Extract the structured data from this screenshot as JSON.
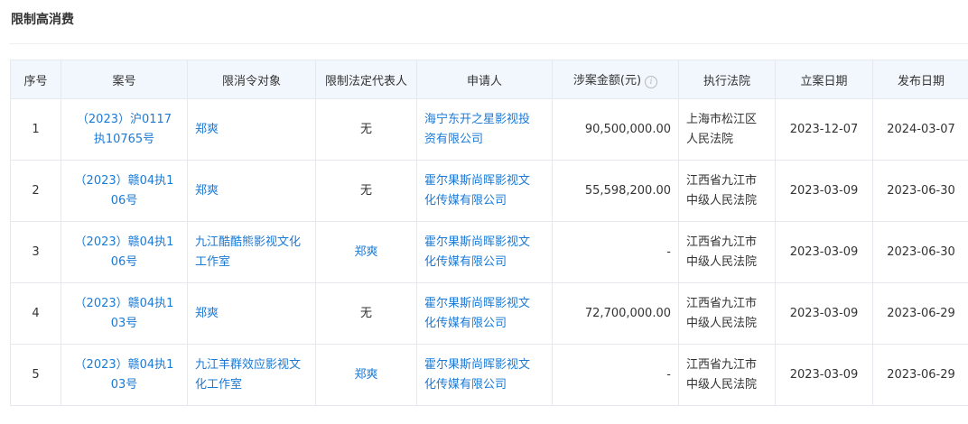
{
  "section": {
    "title": "限制高消费"
  },
  "table": {
    "headers": [
      "序号",
      "案号",
      "限消令对象",
      "限制法定代表人",
      "申请人",
      "涉案金额(元)",
      "执行法院",
      "立案日期",
      "发布日期"
    ],
    "info_icon": "info-circle-icon",
    "rows": [
      {
        "index": "1",
        "case_no": "（2023）沪0117执10765号",
        "case_no_lines": [
          "（2023）沪0117",
          "执10765号"
        ],
        "subject": "郑爽",
        "subject_lines": [
          "郑爽"
        ],
        "subject_link": true,
        "legal_rep": "无",
        "legal_rep_link": false,
        "applicant_lines": [
          "海宁东开之星影视投",
          "资有限公司"
        ],
        "amount": "90,500,000.00",
        "court_lines": [
          "上海市松江区",
          "人民法院"
        ],
        "filed_date": "2023-12-07",
        "publish_date": "2024-03-07"
      },
      {
        "index": "2",
        "case_no_lines": [
          "（2023）赣04执1",
          "06号"
        ],
        "subject_lines": [
          "郑爽"
        ],
        "legal_rep": "无",
        "legal_rep_link": false,
        "applicant_lines": [
          "霍尔果斯尚晖影视文",
          "化传媒有限公司"
        ],
        "amount": "55,598,200.00",
        "court_lines": [
          "江西省九江市",
          "中级人民法院"
        ],
        "filed_date": "2023-03-09",
        "publish_date": "2023-06-30"
      },
      {
        "index": "3",
        "case_no_lines": [
          "（2023）赣04执1",
          "06号"
        ],
        "subject_lines": [
          "九江酷酷熊影视文化",
          "工作室"
        ],
        "legal_rep": "郑爽",
        "legal_rep_link": true,
        "applicant_lines": [
          "霍尔果斯尚晖影视文",
          "化传媒有限公司"
        ],
        "amount": "-",
        "court_lines": [
          "江西省九江市",
          "中级人民法院"
        ],
        "filed_date": "2023-03-09",
        "publish_date": "2023-06-30"
      },
      {
        "index": "4",
        "case_no_lines": [
          "（2023）赣04执1",
          "03号"
        ],
        "subject_lines": [
          "郑爽"
        ],
        "legal_rep": "无",
        "legal_rep_link": false,
        "applicant_lines": [
          "霍尔果斯尚晖影视文",
          "化传媒有限公司"
        ],
        "amount": "72,700,000.00",
        "court_lines": [
          "江西省九江市",
          "中级人民法院"
        ],
        "filed_date": "2023-03-09",
        "publish_date": "2023-06-29"
      },
      {
        "index": "5",
        "case_no_lines": [
          "（2023）赣04执1",
          "03号"
        ],
        "subject_lines": [
          "九江羊群效应影视文",
          "化工作室"
        ],
        "legal_rep": "郑爽",
        "legal_rep_link": true,
        "applicant_lines": [
          "霍尔果斯尚晖影视文",
          "化传媒有限公司"
        ],
        "amount": "-",
        "court_lines": [
          "江西省九江市",
          "中级人民法院"
        ],
        "filed_date": "2023-03-09",
        "publish_date": "2023-06-29"
      }
    ]
  },
  "colors": {
    "link": "#1a7ad6",
    "header_bg": "#f2f7fd",
    "border": "#e6e8ee"
  }
}
